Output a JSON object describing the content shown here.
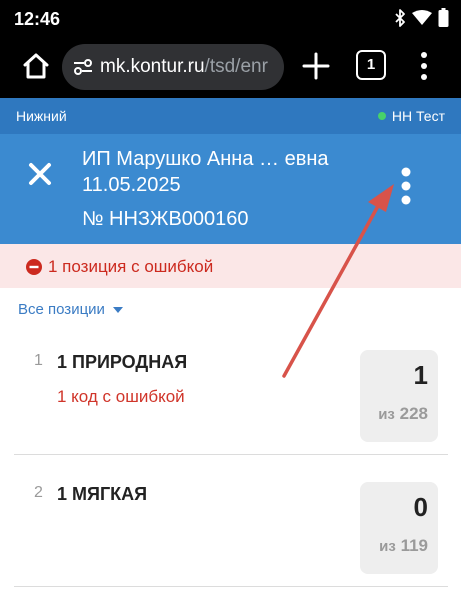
{
  "status_bar": {
    "time": "12:46",
    "icons": [
      "bluetooth-icon",
      "wifi-icon",
      "battery-icon"
    ]
  },
  "browser": {
    "url_domain": "mk.kontur.ru",
    "url_path": "/tsd/enr",
    "tab_count": "1",
    "icons": [
      "home-icon",
      "site-settings-icon",
      "new-tab-plus-icon",
      "tab-switcher-icon",
      "overflow-menu-icon"
    ]
  },
  "location_bar": {
    "location": "Нижний",
    "environment": "НН Тест",
    "environment_status_color": "#47d16a"
  },
  "document": {
    "title": "ИП Марушко Анна … евна 11.05.2025",
    "number": "№ ННЗЖВ000160",
    "icons": [
      "close-icon",
      "kebab-menu-icon"
    ]
  },
  "error_banner": {
    "text": "1 позиция с ошибкой",
    "icon": "error-minus-icon"
  },
  "filter": {
    "label": "Все позиции"
  },
  "items": [
    {
      "index": "1",
      "name": "1 ПРИРОДНАЯ",
      "error": "1 код с ошибкой",
      "qty": "1",
      "of_word": "из",
      "total": "228"
    },
    {
      "index": "2",
      "name": "1 МЯГКАЯ",
      "error": "",
      "qty": "0",
      "of_word": "из",
      "total": "119"
    }
  ],
  "colors": {
    "header_dark": "#2f78bf",
    "header": "#3b8ad0",
    "error_bg": "#fbe7e7",
    "error_text": "#cc2a1f",
    "annotation_arrow": "#d8534a"
  }
}
